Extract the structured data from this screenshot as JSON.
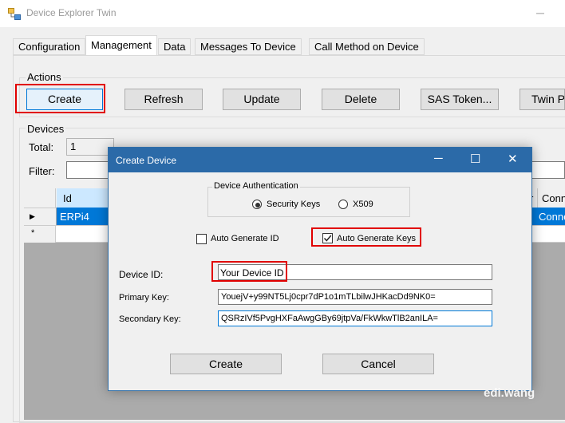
{
  "window": {
    "title": "Device Explorer Twin",
    "minimize_glyph": "─"
  },
  "tabs": [
    "Configuration",
    "Management",
    "Data",
    "Messages To Device",
    "Call Method on Device"
  ],
  "actions": {
    "group_label": "Actions",
    "buttons": [
      "Create",
      "Refresh",
      "Update",
      "Delete",
      "SAS Token...",
      "Twin Pr"
    ]
  },
  "devices": {
    "group_label": "Devices",
    "total_label": "Total:",
    "total_value": "1",
    "filter_label": "Filter:",
    "columns": [
      "Id",
      "r",
      "Conn"
    ],
    "row_id": "ERPi4",
    "row_conn": "Conne",
    "new_row_marker": "*"
  },
  "dialog": {
    "title": "Create Device",
    "auth_group_label": "Device Authentication",
    "auth_options": [
      "Security Keys",
      "X509"
    ],
    "auto_id_label": "Auto Generate ID",
    "auto_keys_label": "Auto Generate Keys",
    "device_id_label": "Device ID:",
    "device_id_value": "Your Device ID",
    "primary_key_label": "Primary Key:",
    "primary_key_value": "YouejV+y99NT5Lj0cpr7dP1o1mTLbilwJHKacDd9NK0=",
    "secondary_key_label": "Secondary Key:",
    "secondary_key_value": "QSRzIVf5PvgHXFaAwgGBy69jtpVa/FkWkwTlB2anILA=",
    "create_label": "Create",
    "cancel_label": "Cancel",
    "controls": [
      "─",
      "☐",
      "✕"
    ]
  },
  "watermark": "edi.wang"
}
